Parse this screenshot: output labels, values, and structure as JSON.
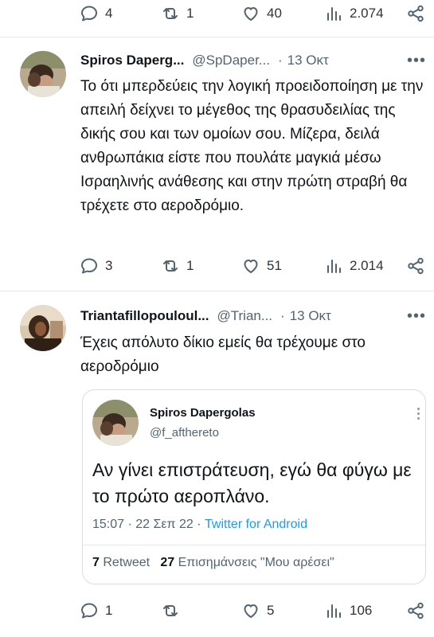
{
  "top_actions": {
    "replies": "4",
    "retweets": "1",
    "likes": "40",
    "views": "2.074"
  },
  "tweets": [
    {
      "name": "Spiros Daperg...",
      "handle": "@SpDaper...",
      "dot": "·",
      "time": "13 Οκτ",
      "more": "•••",
      "text": "Το ότι μπερδεύεις την λογική προειδοποίηση με την απειλή δείχνει το μέγεθος της θρασυδειλίας της δικής σου και των ομοίων σου. Μίζερα, δειλά ανθρωπάκια είστε που πουλάτε μαγκιά μέσω Ισραηλινής ανάθεσης και στην πρώτη στραβή θα τρέχετε στο αεροδρόμιο.",
      "actions": {
        "replies": "3",
        "retweets": "1",
        "likes": "51",
        "views": "2.014"
      }
    },
    {
      "name": "Triantafillopouloul...",
      "handle": "@Trian...",
      "dot": "·",
      "time": "13 Οκτ",
      "more": "•••",
      "text": "Έχεις απόλυτο δίκιο εμείς θα τρέχουμε στο αεροδρόμιο",
      "actions": {
        "replies": "1",
        "retweets": "",
        "likes": "5",
        "views": "106"
      }
    }
  ],
  "quote": {
    "name": "Spiros Dapergolas",
    "handle": "@f_afthereto",
    "text": "Αν γίνει επιστράτευση, εγώ θα φύγω με το πρώτο αεροπλάνο.",
    "datetime": "15:07 · 22 Σεπ 22 · ",
    "client": "Twitter for Android",
    "retweets_count": "7",
    "retweets_label": "Retweet",
    "likes_count": "27",
    "likes_label": "Επισημάνσεις \"Μου αρέσει\""
  },
  "colors": {
    "text": "#0f1419",
    "secondary": "#536471",
    "link": "#1d9bf0",
    "border": "#e4e8eb"
  },
  "icons": [
    "reply-icon",
    "retweet-icon",
    "like-icon",
    "views-icon",
    "share-icon"
  ]
}
